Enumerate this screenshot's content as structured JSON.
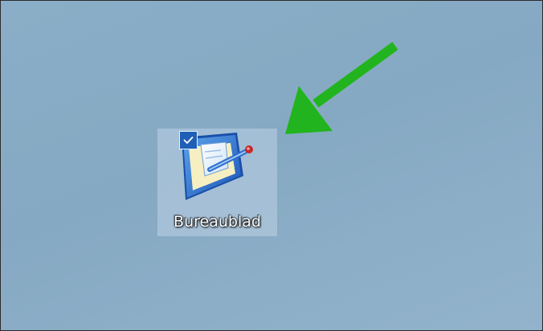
{
  "desktop": {
    "background_color": "#88acc6",
    "icons": [
      {
        "label": "Bureaublad",
        "icon": "desktop-folder-icon",
        "selected": true
      }
    ]
  },
  "annotation": {
    "arrow_color": "#22b41e",
    "arrow_icon": "green-arrow-icon"
  }
}
